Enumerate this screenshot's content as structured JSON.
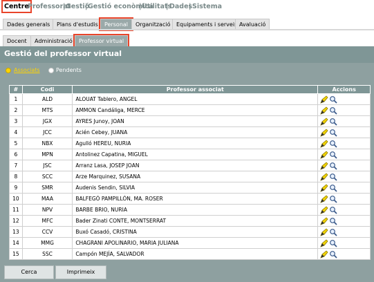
{
  "topnav": {
    "items": [
      "Centre",
      "Professorat",
      "Gestió",
      "Gestió econòmica",
      "Utilitats",
      "Dades",
      "Sistema"
    ]
  },
  "tabs1": [
    "Dades generals",
    "Plans d'estudis",
    "Personal",
    "Organització",
    "Equipaments i serveis",
    "Avaluació"
  ],
  "tabs2": [
    "Docent",
    "Administració",
    "Professor virtual"
  ],
  "title": "Gestió del professor virtual",
  "filters": {
    "assigned": "Associats",
    "pending": "Pendents"
  },
  "table": {
    "headers": [
      "#",
      "Codi",
      "Professor associat",
      "Accions"
    ],
    "rows": [
      [
        "1",
        "ALD",
        "ALOUAT Tablero, ANGEL"
      ],
      [
        "2",
        "MTS",
        "AMMON Candáliga, MERCE"
      ],
      [
        "3",
        "JGX",
        "AYRES Junoy, JOAN"
      ],
      [
        "4",
        "JCC",
        "Acién Cebey, JUANA"
      ],
      [
        "5",
        "NBX",
        "Agulló HEREU, NURIA"
      ],
      [
        "6",
        "MPN",
        "Antolinez Capatina, MIGUEL"
      ],
      [
        "7",
        "JSC",
        "Arranz Lasa, JOSEP JOAN"
      ],
      [
        "8",
        "SCC",
        "Arze Marquinez, SUSANA"
      ],
      [
        "9",
        "SMR",
        "Audenis Sendin, SILVIA"
      ],
      [
        "10",
        "MAA",
        "BALFEGÓ PAMPILLÓN, MA. ROSER"
      ],
      [
        "11",
        "NPV",
        "BARBE BRIO, NURIA"
      ],
      [
        "12",
        "MFC",
        "Bader Zinati CONTE, MONTSERRAT"
      ],
      [
        "13",
        "CCV",
        "Buxó Casadó, CRISTINA"
      ],
      [
        "14",
        "MMG",
        "CHAGRANI APOLINARIO, MARIA JULIANA"
      ],
      [
        "15",
        "SSC",
        "Campón MEJÍA, SALVADOR"
      ]
    ]
  },
  "buttons": {
    "search": "Cerca",
    "print": "Imprimeix"
  },
  "colors": {
    "accent": "#e8442a",
    "header": "#7f9696",
    "panel": "#8ea0a0",
    "radio_on": "#ffd400"
  }
}
